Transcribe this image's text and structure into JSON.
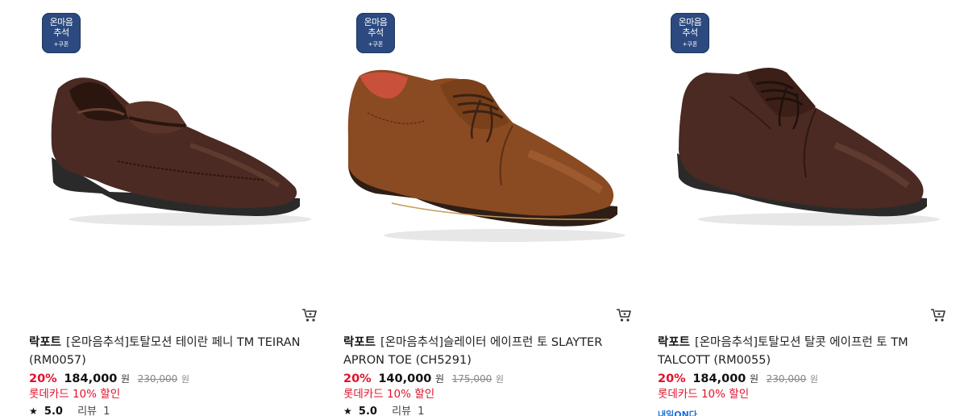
{
  "products": [
    {
      "badge": {
        "line1": "온마음",
        "line2": "추석",
        "line3": "+쿠폰"
      },
      "brand": "락포트",
      "name": "[온마음추석]토탈모션 테이란 페니 TM TEIRAN (RM0057)",
      "discount_rate": "20%",
      "price": "184,000",
      "currency": "원",
      "original_price": "230,000",
      "card_discount": "롯데카드 10% 할인",
      "rating": "5.0",
      "review_label": "리뷰",
      "review_count": "1",
      "shoe_style": "penny-loafer",
      "shoe_color": "#4a2a22"
    },
    {
      "badge": {
        "line1": "온마음",
        "line2": "추석",
        "line3": "+쿠폰"
      },
      "brand": "락포트",
      "name": "[온마음추석]슬레이터 에이프런 토 SLAYTER APRON TOE (CH5291)",
      "discount_rate": "20%",
      "price": "140,000",
      "currency": "원",
      "original_price": "175,000",
      "card_discount": "롯데카드 10% 할인",
      "rating": "5.0",
      "review_label": "리뷰",
      "review_count": "1",
      "shoe_style": "lace-up",
      "shoe_color": "#8a4a22"
    },
    {
      "badge": {
        "line1": "온마음",
        "line2": "추석",
        "line3": "+쿠폰"
      },
      "brand": "락포트",
      "name": "[온마음추석]토탈모션 탈콧 에이프런 토 TM TALCOTT (RM0055)",
      "discount_rate": "20%",
      "price": "184,000",
      "currency": "원",
      "original_price": "230,000",
      "card_discount": "롯데카드 10% 할인",
      "delivery_label": "내일ON다",
      "shoe_style": "lace-up",
      "shoe_color": "#4a2a22"
    }
  ],
  "colors": {
    "badge_bg": "#2c4a7f",
    "discount_red": "#e1112b",
    "delivery_blue": "#1a6fd8"
  },
  "icons": {
    "cart": "cart-icon",
    "star": "star-icon"
  }
}
